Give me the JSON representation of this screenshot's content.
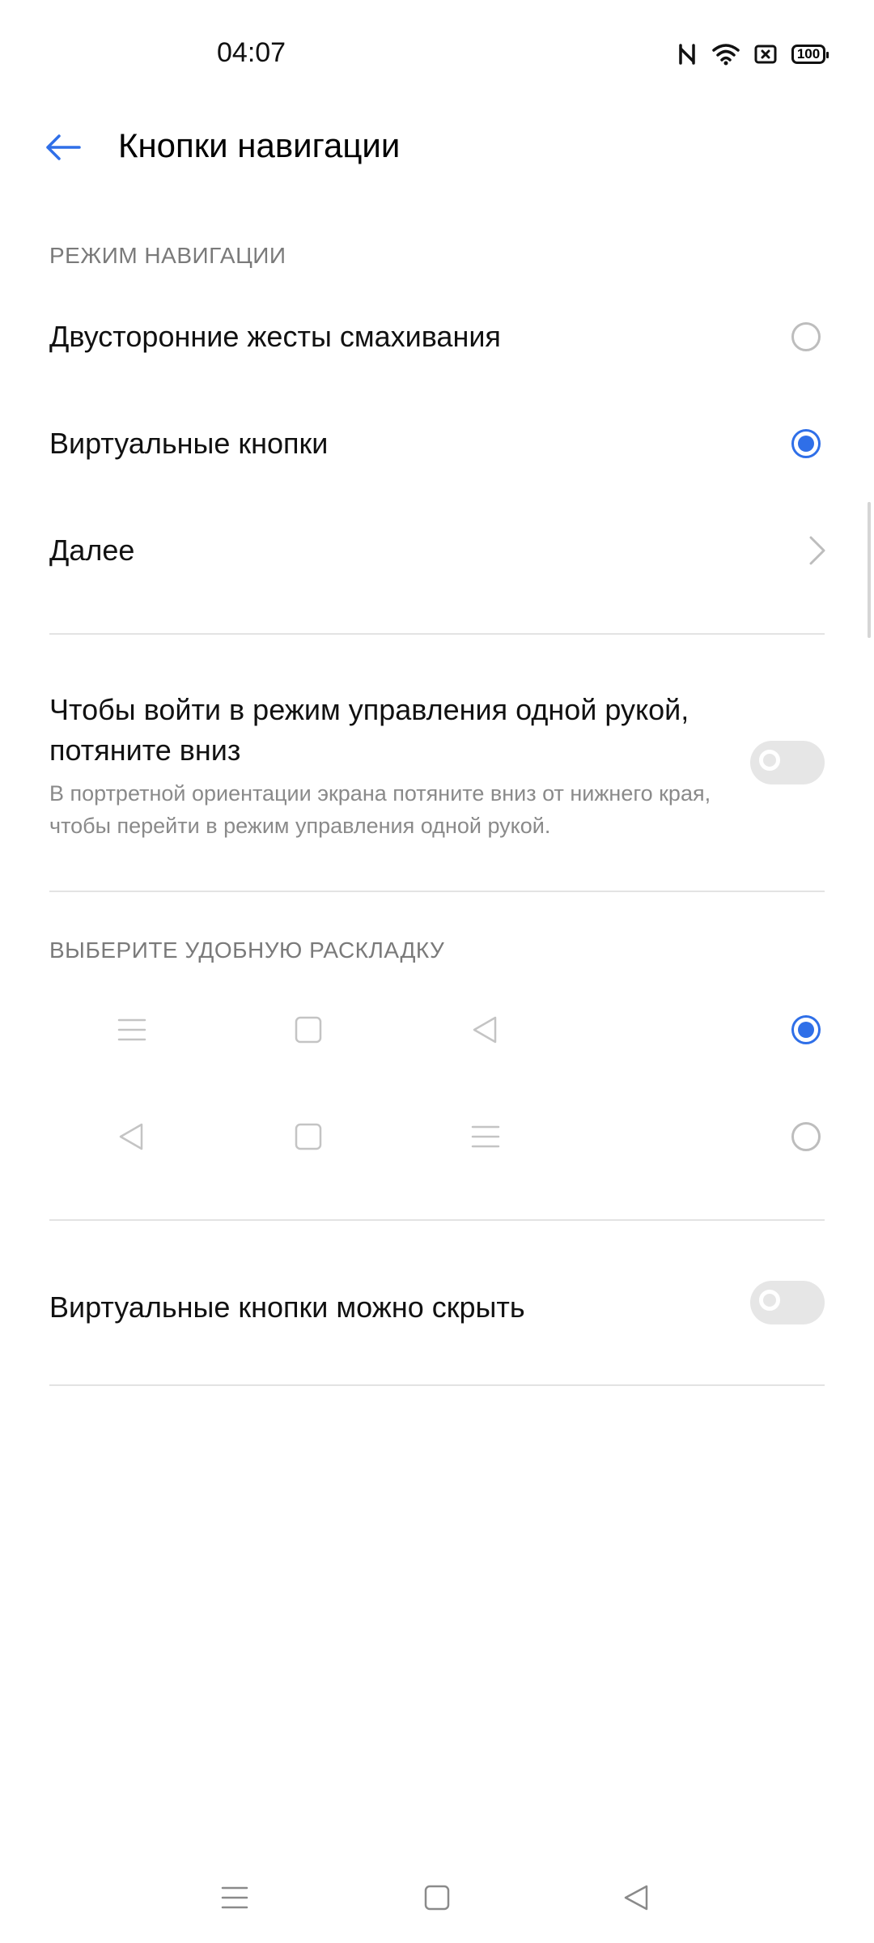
{
  "status_bar": {
    "time": "04:07",
    "battery_level": "100",
    "icons": [
      "nfc-icon",
      "wifi-icon",
      "sim-card-icon",
      "battery-icon"
    ]
  },
  "header": {
    "back_icon": "arrow-left-icon",
    "title": "Кнопки навигации"
  },
  "navigation_mode": {
    "section_title": "РЕЖИМ НАВИГАЦИИ",
    "options": [
      {
        "label": "Двусторонние жесты смахивания",
        "selected": false
      },
      {
        "label": "Виртуальные кнопки",
        "selected": true
      }
    ],
    "more_label": "Далее"
  },
  "one_hand": {
    "title": "Чтобы войти в режим управления одной рукой, потяните вниз",
    "description": "В портретной ориентации экрана потяните вниз от нижнего края, чтобы перейти в режим управления одной рукой.",
    "enabled": false
  },
  "layout": {
    "section_title": "ВЫБЕРИТЕ УДОБНУЮ РАСКЛАДКУ",
    "options": [
      {
        "icons": [
          "menu-icon",
          "home-square-icon",
          "back-triangle-icon"
        ],
        "selected": true
      },
      {
        "icons": [
          "back-triangle-icon",
          "home-square-icon",
          "menu-icon"
        ],
        "selected": false
      }
    ]
  },
  "hide_buttons": {
    "label": "Виртуальные кнопки можно скрыть",
    "enabled": false
  },
  "nav_bar": {
    "icons": [
      "menu-icon",
      "home-square-icon",
      "back-triangle-icon"
    ]
  },
  "colors": {
    "accent": "#2f6fe8",
    "text_primary": "#111111",
    "text_secondary": "#8a8a8a",
    "divider": "#e3e3e3"
  }
}
